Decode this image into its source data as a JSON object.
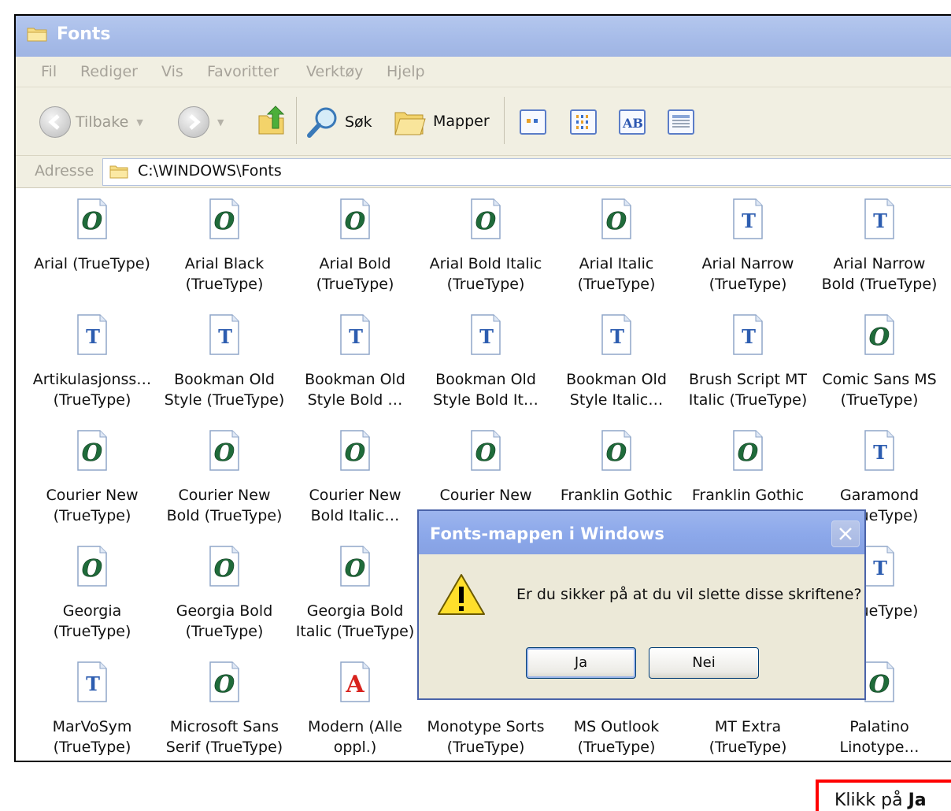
{
  "window": {
    "title": "Fonts"
  },
  "menu": [
    "Fil",
    "Rediger",
    "Vis",
    "Favoritter",
    "Verktøy",
    "Hjelp"
  ],
  "toolbar": {
    "back_label": "Tilbake",
    "search_label": "Søk",
    "folders_label": "Mapper"
  },
  "address": {
    "label": "Adresse",
    "path": "C:\\WINDOWS\\Fonts"
  },
  "fonts": [
    {
      "l1": "Arial (TrueType)",
      "l2": "",
      "icon": "opentype-font-icon"
    },
    {
      "l1": "Arial Black",
      "l2": "(TrueType)",
      "icon": "opentype-font-icon"
    },
    {
      "l1": "Arial Bold",
      "l2": "(TrueType)",
      "icon": "opentype-font-icon"
    },
    {
      "l1": "Arial Bold Italic",
      "l2": "(TrueType)",
      "icon": "opentype-font-icon"
    },
    {
      "l1": "Arial Italic",
      "l2": "(TrueType)",
      "icon": "opentype-font-icon"
    },
    {
      "l1": "Arial Narrow",
      "l2": "(TrueType)",
      "icon": "truetype-font-icon"
    },
    {
      "l1": "Arial Narrow",
      "l2": "Bold (TrueType)",
      "icon": "truetype-font-icon"
    },
    {
      "l1": "Artikulasjonss…",
      "l2": "(TrueType)",
      "icon": "truetype-font-icon"
    },
    {
      "l1": "Bookman Old",
      "l2": "Style (TrueType)",
      "icon": "truetype-font-icon"
    },
    {
      "l1": "Bookman Old",
      "l2": "Style Bold …",
      "icon": "truetype-font-icon"
    },
    {
      "l1": "Bookman Old",
      "l2": "Style Bold It…",
      "icon": "truetype-font-icon"
    },
    {
      "l1": "Bookman Old",
      "l2": "Style Italic…",
      "icon": "truetype-font-icon"
    },
    {
      "l1": "Brush Script MT",
      "l2": "Italic (TrueType)",
      "icon": "truetype-font-icon"
    },
    {
      "l1": "Comic Sans MS",
      "l2": "(TrueType)",
      "icon": "opentype-font-icon"
    },
    {
      "l1": "Courier New",
      "l2": "(TrueType)",
      "icon": "opentype-font-icon"
    },
    {
      "l1": "Courier New",
      "l2": "Bold (TrueType)",
      "icon": "opentype-font-icon"
    },
    {
      "l1": "Courier New",
      "l2": "Bold Italic…",
      "icon": "opentype-font-icon"
    },
    {
      "l1": "Courier New",
      "l2": "",
      "icon": "opentype-font-icon"
    },
    {
      "l1": "Franklin Gothic",
      "l2": "",
      "icon": "opentype-font-icon"
    },
    {
      "l1": "Franklin Gothic",
      "l2": "",
      "icon": "opentype-font-icon"
    },
    {
      "l1": "Garamond",
      "l2": "(TrueType)",
      "icon": "truetype-font-icon"
    },
    {
      "l1": "Georgia",
      "l2": "(TrueType)",
      "icon": "opentype-font-icon"
    },
    {
      "l1": "Georgia Bold",
      "l2": "(TrueType)",
      "icon": "opentype-font-icon"
    },
    {
      "l1": "Georgia Bold",
      "l2": "Italic (TrueType)",
      "icon": "opentype-font-icon"
    },
    {
      "l1": "",
      "l2": "",
      "icon": ""
    },
    {
      "l1": "",
      "l2": "",
      "icon": ""
    },
    {
      "l1": "",
      "l2": "",
      "icon": ""
    },
    {
      "l1": "",
      "l2": "(TrueType)",
      "icon": "truetype-font-icon"
    },
    {
      "l1": "MarVoSym",
      "l2": "(TrueType)",
      "icon": "truetype-font-icon"
    },
    {
      "l1": "Microsoft Sans",
      "l2": "Serif (TrueType)",
      "icon": "opentype-font-icon"
    },
    {
      "l1": "Modern (Alle",
      "l2": "oppl.)",
      "icon": "raster-font-icon"
    },
    {
      "l1": "Monotype Sorts",
      "l2": "(TrueType)",
      "icon": ""
    },
    {
      "l1": "MS Outlook",
      "l2": "(TrueType)",
      "icon": ""
    },
    {
      "l1": "MT Extra",
      "l2": "(TrueType)",
      "icon": ""
    },
    {
      "l1": "Palatino",
      "l2": "Linotype…",
      "icon": "opentype-font-icon"
    }
  ],
  "dialog": {
    "title": "Fonts-mappen i Windows",
    "message": "Er du sikker på at du vil slette disse skriftene?",
    "yes_label": "Ja",
    "no_label": "Nei"
  },
  "hint": {
    "prefix": "Klikk på ",
    "bold": "Ja"
  }
}
